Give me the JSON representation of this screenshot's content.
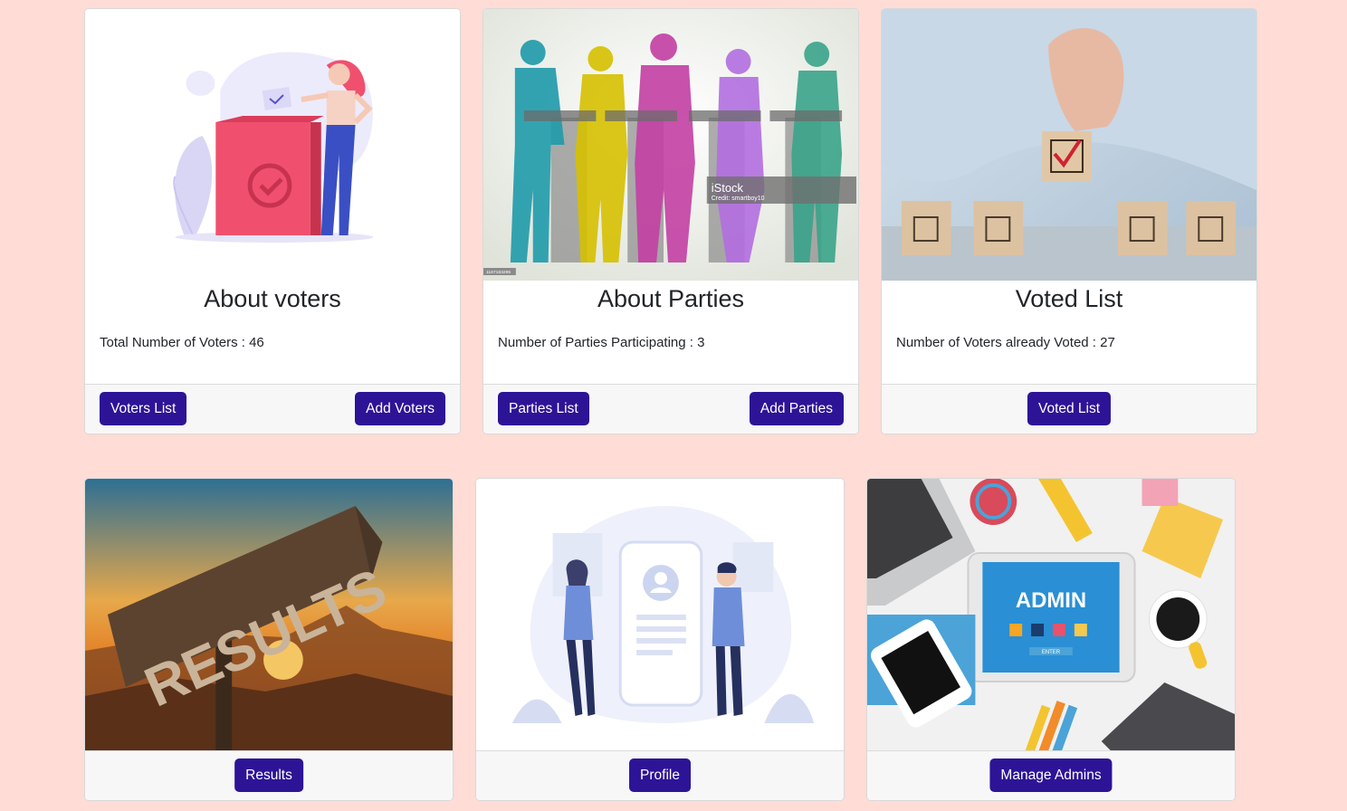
{
  "cards": [
    {
      "title": "About voters",
      "text": "Total Number of Voters : 46",
      "buttons": [
        "Voters List",
        "Add Voters"
      ]
    },
    {
      "title": "About Parties",
      "text": "Number of Parties Participating : 3",
      "buttons": [
        "Parties List",
        "Add Parties"
      ],
      "image_text": {
        "brand": "iStock",
        "credit": "Credit: smartboy10",
        "id": "1167163295"
      }
    },
    {
      "title": "Voted List",
      "text": "Number of Voters already Voted : 27",
      "buttons": [
        "Voted List"
      ]
    },
    {
      "buttons": [
        "Results"
      ],
      "image_text": {
        "sign": "RESULTS"
      }
    },
    {
      "buttons": [
        "Profile"
      ]
    },
    {
      "buttons": [
        "Manage Admins"
      ],
      "image_text": {
        "screen": "ADMIN",
        "enter": "ENTER"
      }
    }
  ],
  "colors": {
    "background": "#ffdcd6",
    "button": "#2d1496",
    "footer": "#f7f7f7"
  }
}
